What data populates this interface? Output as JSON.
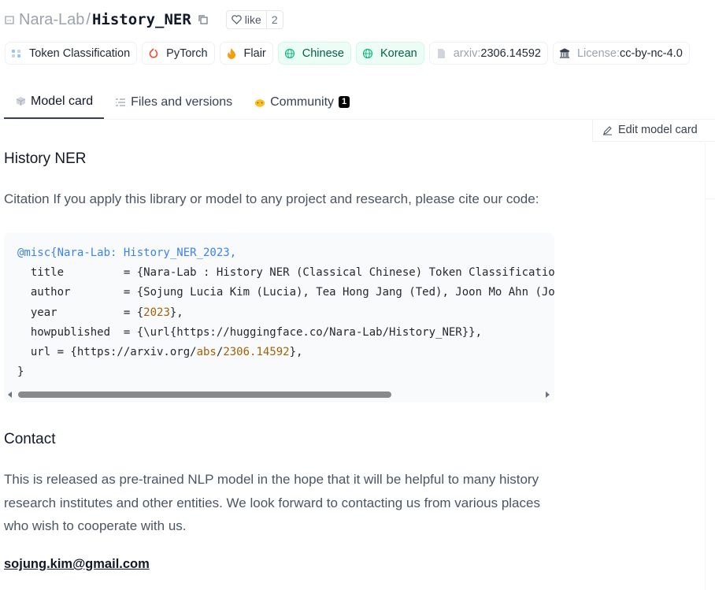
{
  "header": {
    "org": "Nara-Lab",
    "separator": "/",
    "model_name": "History_NER",
    "like_label": "like",
    "like_count": "2"
  },
  "tags": [
    {
      "label": "Token Classification",
      "icon": "token-classification-icon"
    },
    {
      "label": "PyTorch",
      "icon": "pytorch-icon"
    },
    {
      "label": "Flair",
      "icon": "flair-icon"
    },
    {
      "label": "Chinese",
      "icon": "globe-icon"
    },
    {
      "label": "Korean",
      "icon": "globe-icon"
    },
    {
      "prefix": "arxiv:",
      "label": "2306.14592",
      "icon": "document-icon"
    },
    {
      "prefix": "License: ",
      "label": "cc-by-nc-4.0",
      "icon": "license-icon"
    }
  ],
  "tabs": [
    {
      "label": "Model card",
      "active": true
    },
    {
      "label": "Files and versions"
    },
    {
      "label": "Community",
      "badge": "1"
    }
  ],
  "edit_button": "Edit model card",
  "content": {
    "heading1": "History NER",
    "citation_text": "Citation If you apply this library or model to any project and research, please cite our code:",
    "code": {
      "line1_kw": "@misc{Nara-Lab: History_NER_2023,",
      "line2": "  title         = {Nara-Lab : History NER (Classical Chinese) Token Classification},",
      "line3": "  author        = {Sojung Lucia Kim (Lucia), Tea Hong Jang (Ted), Joon Mo Ahn (Joon)},",
      "line4_pre": "  year          = {",
      "line4_num": "2023",
      "line4_post": "},",
      "line5": "  howpublished  = {\\url{https://huggingface.co/Nara-Lab/History_NER}},",
      "line6_pre": "  url = {https://arxiv.org/",
      "line6_abs": "abs",
      "line6_sep": "/",
      "line6_num": "2306.14592",
      "line6_post": "},",
      "line7": "}"
    },
    "heading2": "Contact",
    "contact_text": "This is released as pre-trained NLP model in the hope that it will be helpful to many history research institutes and other entities. We look forward to contacting us from various places who wish to cooperate with us.",
    "email": "sojung.kim@gmail.com"
  },
  "colors": {
    "lang_tag_bg": "#ecfdf5",
    "lang_tag_text": "#065f46",
    "code_keyword": "#3b82f6",
    "code_number": "#a16207",
    "badge_bg": "#000000"
  }
}
